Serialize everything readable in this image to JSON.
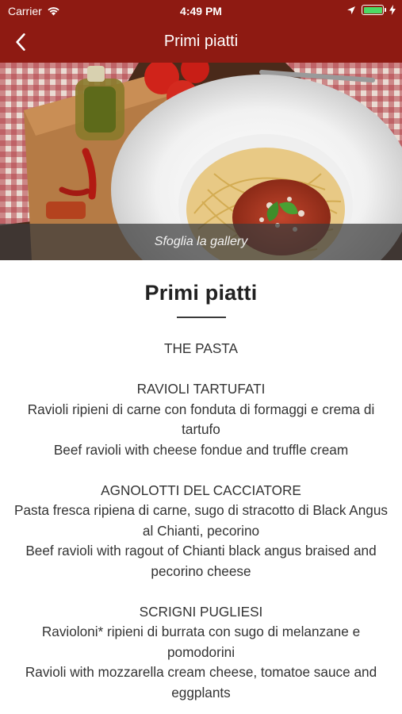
{
  "status_bar": {
    "carrier": "Carrier",
    "time": "4:49 PM",
    "battery_color": "#4cd964"
  },
  "nav": {
    "back_icon": "chevron-left-icon",
    "title": "Primi piatti"
  },
  "hero": {
    "gallery_label": "Sfoglia la gallery"
  },
  "content": {
    "heading": "Primi piatti",
    "section_title": "THE PASTA",
    "dishes": [
      {
        "name": "RAVIOLI TARTUFATI",
        "desc_it": "Ravioli ripieni di carne con fonduta di formaggi e crema di tartufo",
        "desc_en": "Beef ravioli with cheese fondue and truffle cream"
      },
      {
        "name": "AGNOLOTTI DEL CACCIATORE",
        "desc_it": "Pasta fresca ripiena di carne, sugo di stracotto di Black Angus al Chianti, pecorino",
        "desc_en": "Beef ravioli with ragout of Chianti black angus braised and pecorino cheese"
      },
      {
        "name": "SCRIGNI PUGLIESI",
        "desc_it": "Ravioloni* ripieni di burrata con sugo di melanzane e pomodorini",
        "desc_en": "Ravioli with mozzarella cream cheese, tomatoe sauce and eggplants"
      }
    ]
  },
  "colors": {
    "brand": "#8e1a12",
    "gallery_overlay": "rgba(60,60,60,0.72)"
  }
}
